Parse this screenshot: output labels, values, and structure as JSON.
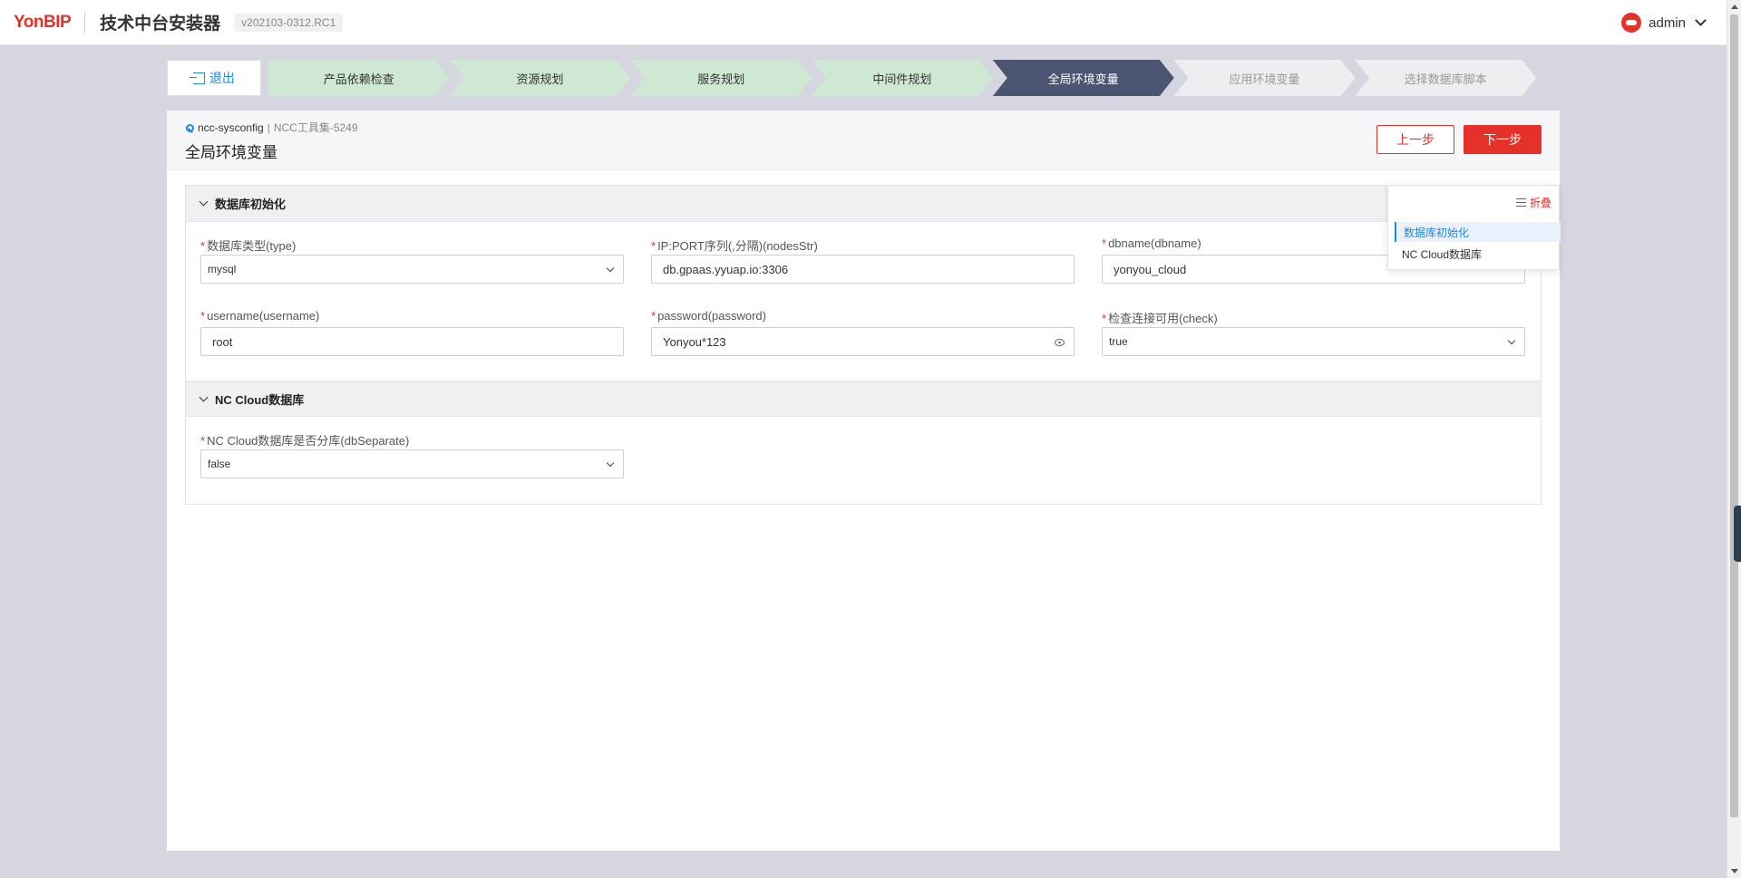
{
  "header": {
    "logo": "YonBIP",
    "app_title": "技术中台安装器",
    "version": "v202103-0312.RC1",
    "user": "admin"
  },
  "steps": {
    "exit_label": "退出",
    "items": [
      {
        "label": "产品依赖检查",
        "state": "done"
      },
      {
        "label": "资源规划",
        "state": "done"
      },
      {
        "label": "服务规划",
        "state": "done"
      },
      {
        "label": "中间件规划",
        "state": "done"
      },
      {
        "label": "全局环境变量",
        "state": "active"
      },
      {
        "label": "应用环境变量",
        "state": "todo"
      },
      {
        "label": "选择数据库脚本",
        "state": "todo"
      }
    ]
  },
  "panel": {
    "crumb_name": "ncc-sysconfig",
    "crumb_sep": "|",
    "crumb_sub": "NCC工具集-5249",
    "title": "全局环境变量",
    "prev_label": "上一步",
    "next_label": "下一步"
  },
  "sections": [
    {
      "title": "数据库初始化",
      "fields": [
        {
          "label": "数据库类型(type)",
          "value": "mysql",
          "kind": "select"
        },
        {
          "label": "IP:PORT序列(,分隔)(nodesStr)",
          "value": "db.gpaas.yyuap.io:3306",
          "kind": "text"
        },
        {
          "label": "dbname(dbname)",
          "value": "yonyou_cloud",
          "kind": "text"
        },
        {
          "label": "username(username)",
          "value": "root",
          "kind": "text"
        },
        {
          "label": "password(password)",
          "value": "Yonyou*123",
          "kind": "password"
        },
        {
          "label": "检查连接可用(check)",
          "value": "true",
          "kind": "select"
        }
      ]
    },
    {
      "title": "NC Cloud数据库",
      "fields": [
        {
          "label": "NC Cloud数据库是否分库(dbSeparate)",
          "value": "false",
          "kind": "select"
        }
      ]
    }
  ],
  "float_nav": {
    "fold_label": "折叠",
    "items": [
      "数据库初始化",
      "NC Cloud数据库"
    ]
  },
  "colors": {
    "brand_red": "#e4322b",
    "step_done": "#cfe8d3",
    "step_active": "#4b5572",
    "step_todo": "#eeeef1",
    "link_blue": "#1e88e5"
  }
}
